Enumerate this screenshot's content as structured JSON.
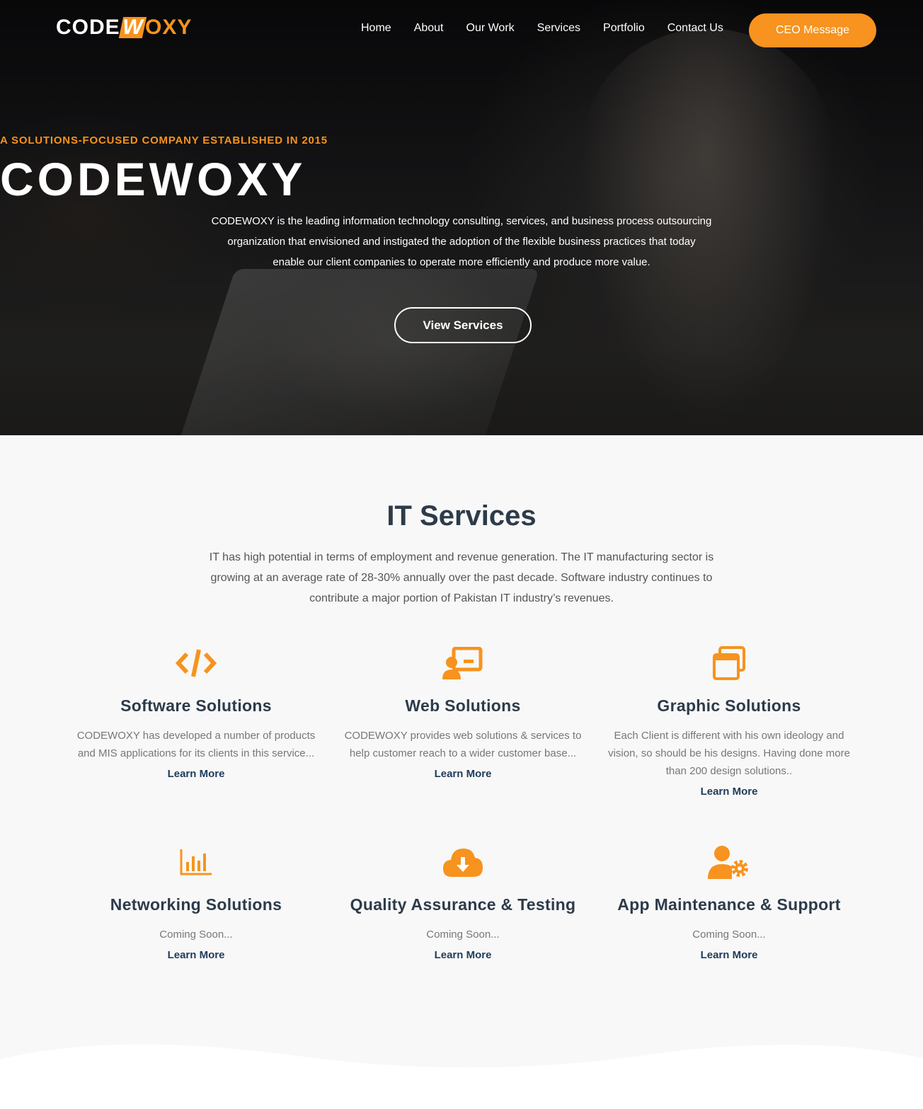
{
  "brand": {
    "logo_part1": "CODE",
    "logo_part2": "W",
    "logo_part3": "OXY",
    "accent_color": "#f7931e",
    "dark_color": "#2d3b4a"
  },
  "nav": {
    "items": [
      "Home",
      "About",
      "Our Work",
      "Services",
      "Portfolio",
      "Contact Us"
    ],
    "cta_label": "CEO Message"
  },
  "hero": {
    "tagline": "A SOLUTIONS-FOCUSED COMPANY ESTABLISHED IN 2015",
    "title": "CODEWOXY",
    "description": "CODEWOXY is the leading information technology consulting, services, and business process outsourcing organization that envisioned and instigated the adoption of the flexible business practices that today enable our client companies to operate more efficiently and produce more value.",
    "button_label": "View Services"
  },
  "services": {
    "title": "IT Services",
    "description": "IT has high potential in terms of employment and revenue generation. The IT manufacturing sector is growing at an average rate of 28-30% annually over the past decade. Software industry continues to contribute a major portion of Pakistan IT industry’s revenues.",
    "cards": [
      {
        "icon": "code-icon",
        "title": "Software Solutions",
        "text": "CODEWOXY has developed a number of products and MIS applications for its clients in this service...",
        "link": "Learn More"
      },
      {
        "icon": "presentation-user-icon",
        "title": "Web Solutions",
        "text": "CODEWOXY provides web solutions & services to help customer reach to a wider customer base...",
        "link": "Learn More"
      },
      {
        "icon": "windows-stack-icon",
        "title": "Graphic Solutions",
        "text": "Each Client is different with his own ideology and vision, so should be his designs. Having done more than 200 design solutions..",
        "link": "Learn More"
      },
      {
        "icon": "bar-chart-icon",
        "title": "Networking Solutions",
        "text": "Coming Soon...",
        "link": "Learn More"
      },
      {
        "icon": "cloud-download-icon",
        "title": "Quality Assurance & Testing",
        "text": "Coming Soon...",
        "link": "Learn More"
      },
      {
        "icon": "user-gear-icon",
        "title": "App Maintenance & Support",
        "text": "Coming Soon...",
        "link": "Learn More"
      }
    ]
  }
}
